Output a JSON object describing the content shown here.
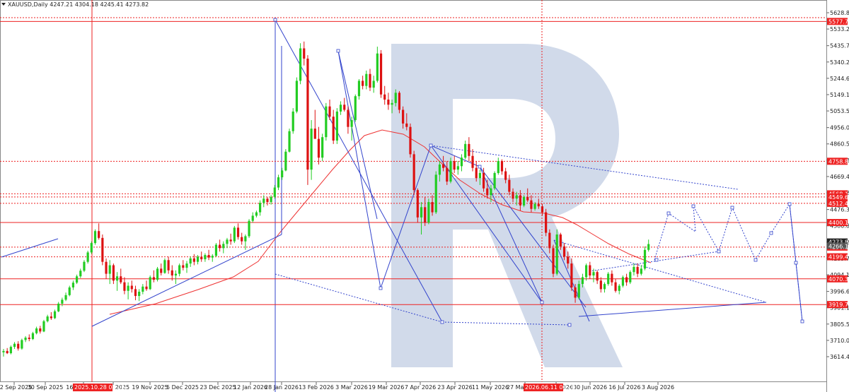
{
  "chart_data": {
    "type": "candlestick",
    "title": "XAUUSD,Daily  4247.21 4304.18 4245.41 4273.82",
    "symbol": "XAUUSD",
    "timeframe": "Daily",
    "ohlc_readout": {
      "open": 4247.21,
      "high": 4304.18,
      "low": 4245.41,
      "close": 4273.82
    },
    "ylim": [
      3550,
      5700
    ],
    "y_ticks": [
      "5628.80",
      "5533.25",
      "5435.75",
      "5340.20",
      "5244.65",
      "5149.10",
      "5053.55",
      "4956.00",
      "4860.50",
      "4765.35",
      "4669.40",
      "4573.85",
      "4476.35",
      "4380.80",
      "4285.25",
      "4189.70",
      "4094.15",
      "3996.65",
      "3901.10",
      "3805.55",
      "3710.00",
      "3614.45"
    ],
    "x_ticks": [
      "12 Sep 2025",
      "30 Sep 2025",
      "16 Oct 2025",
      "3 Nov 2025",
      "19 Nov 2025",
      "5 Dec 2025",
      "23 Dec 2025",
      "12 Jan 2026",
      "28 Jan 2026",
      "13 Feb 2026",
      "3 Mar 2026",
      "19 Mar 2026",
      "7 Apr 2026",
      "23 Apr 2026",
      "11 May 2026",
      "27 May 2026",
      "12 Jun 2026",
      "30 Jun 2026",
      "16 Jul 2026",
      "3 Aug 2026"
    ],
    "level_tags": [
      "5577.71",
      "4758.89",
      "4568.16",
      "4549.60",
      "4512.44",
      "4400.18",
      "4256.18",
      "4199.45",
      "4070.35",
      "3919.72"
    ],
    "current_price_tags": [
      "4273.82",
      "4266.10"
    ],
    "date_tags": [
      "2025.10.28 00:00",
      "2026.06.11 00:00"
    ],
    "colors": {
      "bull": "#22cc22",
      "bear": "#dd1111",
      "level": "#ee2222",
      "forecast": "#3344cc",
      "ma": "#ee3333",
      "watermark": "#c9d3e6"
    },
    "candles": [
      [
        3640,
        3660,
        3615,
        3648
      ],
      [
        3648,
        3665,
        3630,
        3635
      ],
      [
        3635,
        3680,
        3628,
        3672
      ],
      [
        3672,
        3700,
        3660,
        3690
      ],
      [
        3690,
        3705,
        3650,
        3662
      ],
      [
        3662,
        3720,
        3655,
        3712
      ],
      [
        3712,
        3735,
        3700,
        3726
      ],
      [
        3726,
        3745,
        3705,
        3718
      ],
      [
        3718,
        3760,
        3712,
        3752
      ],
      [
        3752,
        3790,
        3745,
        3780
      ],
      [
        3780,
        3795,
        3750,
        3762
      ],
      [
        3762,
        3830,
        3758,
        3822
      ],
      [
        3822,
        3860,
        3815,
        3850
      ],
      [
        3850,
        3875,
        3830,
        3840
      ],
      [
        3840,
        3890,
        3835,
        3880
      ],
      [
        3880,
        3935,
        3875,
        3925
      ],
      [
        3925,
        3960,
        3910,
        3948
      ],
      [
        3948,
        3990,
        3940,
        3975
      ],
      [
        3975,
        4030,
        3968,
        4020
      ],
      [
        4020,
        4060,
        4005,
        4048
      ],
      [
        4048,
        4095,
        4040,
        4085
      ],
      [
        4085,
        4130,
        4075,
        4118
      ],
      [
        4118,
        4180,
        4110,
        4170
      ],
      [
        4170,
        4235,
        4160,
        4225
      ],
      [
        4225,
        4290,
        4215,
        4280
      ],
      [
        4280,
        4360,
        4270,
        4350
      ],
      [
        4350,
        4395,
        4300,
        4310
      ],
      [
        4310,
        4330,
        4150,
        4170
      ],
      [
        4170,
        4190,
        4070,
        4100
      ],
      [
        4100,
        4180,
        4040,
        4150
      ],
      [
        4150,
        4160,
        4040,
        4060
      ],
      [
        4060,
        4110,
        4000,
        4085
      ],
      [
        4085,
        4130,
        4040,
        4050
      ],
      [
        4050,
        4080,
        3980,
        4000
      ],
      [
        4000,
        4050,
        3950,
        4030
      ],
      [
        4030,
        4060,
        3990,
        4010
      ],
      [
        4010,
        4030,
        3945,
        3970
      ],
      [
        3970,
        4010,
        3940,
        3995
      ],
      [
        3995,
        4040,
        3980,
        4025
      ],
      [
        4025,
        4060,
        4000,
        4010
      ],
      [
        4010,
        4090,
        4005,
        4080
      ],
      [
        4080,
        4120,
        4050,
        4065
      ],
      [
        4065,
        4140,
        4055,
        4130
      ],
      [
        4130,
        4160,
        4090,
        4105
      ],
      [
        4105,
        4190,
        4100,
        4180
      ],
      [
        4180,
        4200,
        4100,
        4120
      ],
      [
        4120,
        4150,
        4060,
        4090
      ],
      [
        4090,
        4120,
        4040,
        4100
      ],
      [
        4100,
        4160,
        4085,
        4150
      ],
      [
        4150,
        4180,
        4120,
        4135
      ],
      [
        4135,
        4175,
        4105,
        4160
      ],
      [
        4160,
        4200,
        4140,
        4190
      ],
      [
        4190,
        4215,
        4150,
        4170
      ],
      [
        4170,
        4210,
        4155,
        4200
      ],
      [
        4200,
        4230,
        4170,
        4185
      ],
      [
        4185,
        4220,
        4170,
        4210
      ],
      [
        4210,
        4240,
        4180,
        4195
      ],
      [
        4195,
        4215,
        4170,
        4205
      ],
      [
        4205,
        4280,
        4200,
        4270
      ],
      [
        4270,
        4300,
        4230,
        4250
      ],
      [
        4250,
        4290,
        4220,
        4275
      ],
      [
        4275,
        4310,
        4250,
        4300
      ],
      [
        4300,
        4335,
        4270,
        4290
      ],
      [
        4290,
        4380,
        4280,
        4370
      ],
      [
        4370,
        4395,
        4300,
        4315
      ],
      [
        4315,
        4340,
        4270,
        4290
      ],
      [
        4290,
        4330,
        4240,
        4320
      ],
      [
        4320,
        4420,
        4310,
        4410
      ],
      [
        4410,
        4460,
        4400,
        4440
      ],
      [
        4440,
        4470,
        4430,
        4460
      ],
      [
        4460,
        4530,
        4440,
        4515
      ],
      [
        4515,
        4560,
        4490,
        4540
      ],
      [
        4540,
        4550,
        4500,
        4520
      ],
      [
        4520,
        4560,
        4505,
        4550
      ],
      [
        4550,
        4620,
        4540,
        4605
      ],
      [
        4605,
        4680,
        4590,
        4665
      ],
      [
        4665,
        4720,
        4650,
        4705
      ],
      [
        4705,
        4830,
        4700,
        4815
      ],
      [
        4815,
        4950,
        4810,
        4935
      ],
      [
        4935,
        5070,
        4920,
        5050
      ],
      [
        5050,
        5250,
        5040,
        5230
      ],
      [
        5230,
        5450,
        5210,
        5420
      ],
      [
        5420,
        5460,
        5320,
        5360
      ],
      [
        5360,
        5380,
        4620,
        4710
      ],
      [
        4710,
        5000,
        4650,
        4950
      ],
      [
        4950,
        5060,
        4900,
        4890
      ],
      [
        4890,
        4960,
        4740,
        4780
      ],
      [
        4780,
        4920,
        4760,
        4900
      ],
      [
        4900,
        5100,
        4880,
        5080
      ],
      [
        5080,
        5120,
        5000,
        5020
      ],
      [
        5020,
        5060,
        4860,
        4880
      ],
      [
        4880,
        5070,
        4860,
        5050
      ],
      [
        5050,
        5110,
        5030,
        5090
      ],
      [
        5090,
        5130,
        5050,
        5060
      ],
      [
        5060,
        5080,
        4920,
        4960
      ],
      [
        4960,
        5020,
        4880,
        5000
      ],
      [
        5000,
        5150,
        4990,
        5140
      ],
      [
        5140,
        5240,
        5120,
        5230
      ],
      [
        5230,
        5260,
        5180,
        5200
      ],
      [
        5200,
        5290,
        5180,
        5270
      ],
      [
        5270,
        5300,
        5170,
        5190
      ],
      [
        5190,
        5260,
        5160,
        5230
      ],
      [
        5230,
        5430,
        5220,
        5390
      ],
      [
        5390,
        5410,
        5130,
        5150
      ],
      [
        5150,
        5200,
        5090,
        5120
      ],
      [
        5120,
        5160,
        5060,
        5090
      ],
      [
        5090,
        5120,
        5040,
        5100
      ],
      [
        5100,
        5180,
        5080,
        5160
      ],
      [
        5160,
        5170,
        5040,
        5060
      ],
      [
        5060,
        5080,
        4950,
        4980
      ],
      [
        4980,
        5040,
        4940,
        4960
      ],
      [
        4960,
        4980,
        4780,
        4800
      ],
      [
        4800,
        4820,
        4560,
        4590
      ],
      [
        4590,
        4600,
        4400,
        4430
      ],
      [
        4430,
        4520,
        4330,
        4490
      ],
      [
        4490,
        4550,
        4380,
        4400
      ],
      [
        4400,
        4540,
        4390,
        4520
      ],
      [
        4520,
        4560,
        4440,
        4460
      ],
      [
        4460,
        4700,
        4450,
        4680
      ],
      [
        4680,
        4760,
        4640,
        4740
      ],
      [
        4740,
        4790,
        4700,
        4720
      ],
      [
        4720,
        4760,
        4620,
        4640
      ],
      [
        4640,
        4780,
        4630,
        4760
      ],
      [
        4760,
        4790,
        4690,
        4710
      ],
      [
        4710,
        4760,
        4680,
        4730
      ],
      [
        4730,
        4800,
        4700,
        4780
      ],
      [
        4780,
        4880,
        4770,
        4860
      ],
      [
        4860,
        4900,
        4760,
        4790
      ],
      [
        4790,
        4830,
        4700,
        4720
      ],
      [
        4720,
        4760,
        4640,
        4660
      ],
      [
        4660,
        4710,
        4620,
        4690
      ],
      [
        4690,
        4720,
        4580,
        4600
      ],
      [
        4600,
        4650,
        4540,
        4560
      ],
      [
        4560,
        4620,
        4520,
        4600
      ],
      [
        4600,
        4700,
        4590,
        4690
      ],
      [
        4690,
        4780,
        4680,
        4760
      ],
      [
        4760,
        4770,
        4680,
        4700
      ],
      [
        4700,
        4720,
        4630,
        4650
      ],
      [
        4650,
        4680,
        4560,
        4580
      ],
      [
        4580,
        4600,
        4520,
        4540
      ],
      [
        4540,
        4580,
        4500,
        4560
      ],
      [
        4560,
        4590,
        4470,
        4500
      ],
      [
        4500,
        4560,
        4490,
        4550
      ],
      [
        4550,
        4600,
        4520,
        4530
      ],
      [
        4530,
        4560,
        4460,
        4480
      ],
      [
        4480,
        4520,
        4470,
        4510
      ],
      [
        4510,
        4540,
        4480,
        4495
      ],
      [
        4495,
        4510,
        4440,
        4460
      ],
      [
        4460,
        4480,
        4320,
        4340
      ],
      [
        4340,
        4360,
        4220,
        4250
      ],
      [
        4250,
        4270,
        4080,
        4100
      ],
      [
        4100,
        4360,
        4090,
        4330
      ],
      [
        4330,
        4340,
        4240,
        4260
      ],
      [
        4260,
        4280,
        4180,
        4200
      ],
      [
        4200,
        4230,
        4130,
        4160
      ],
      [
        4160,
        4190,
        4000,
        4020
      ],
      [
        4020,
        4040,
        3930,
        3960
      ],
      [
        3960,
        4060,
        3950,
        4040
      ],
      [
        4040,
        4100,
        4020,
        4080
      ],
      [
        4080,
        4160,
        4060,
        4150
      ],
      [
        4150,
        4170,
        4070,
        4090
      ],
      [
        4090,
        4130,
        4050,
        4110
      ],
      [
        4110,
        4120,
        4040,
        4060
      ],
      [
        4060,
        4080,
        3990,
        4010
      ],
      [
        4010,
        4050,
        3990,
        4040
      ],
      [
        4040,
        4110,
        4030,
        4100
      ],
      [
        4100,
        4120,
        4030,
        4050
      ],
      [
        4050,
        4070,
        3990,
        4000
      ],
      [
        4000,
        4040,
        3980,
        4030
      ],
      [
        4030,
        4090,
        4020,
        4080
      ],
      [
        4080,
        4100,
        4030,
        4050
      ],
      [
        4050,
        4120,
        4040,
        4110
      ],
      [
        4110,
        4160,
        4090,
        4140
      ],
      [
        4140,
        4160,
        4080,
        4100
      ],
      [
        4100,
        4150,
        4090,
        4130
      ],
      [
        4130,
        4260,
        4120,
        4240
      ],
      [
        4240,
        4300,
        4230,
        4274
      ]
    ]
  }
}
